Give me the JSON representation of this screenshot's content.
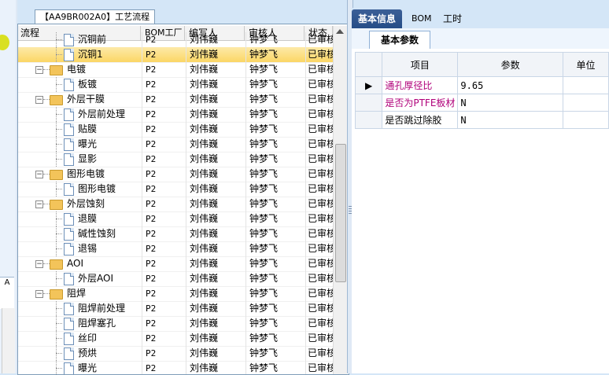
{
  "left_strip": {
    "label_a": "A",
    "label_b": ""
  },
  "process_panel": {
    "tab_label": "【AA9BR002A0】工艺流程",
    "columns": [
      "流程",
      "BOM工厂",
      "编写人",
      "审核人",
      "状态"
    ],
    "rows": [
      {
        "name": "沉铜前",
        "level": 2,
        "type": "doc",
        "bom": "P2",
        "writer": "刘伟巍",
        "reviewer": "钟梦飞",
        "status": "已审核",
        "selected": false
      },
      {
        "name": "沉铜1",
        "level": 2,
        "type": "doc",
        "bom": "P2",
        "writer": "刘伟巍",
        "reviewer": "钟梦飞",
        "status": "已审核",
        "selected": true
      },
      {
        "name": "电镀",
        "level": 1,
        "type": "folder",
        "bom": "P2",
        "writer": "刘伟巍",
        "reviewer": "钟梦飞",
        "status": "已审核",
        "selected": false
      },
      {
        "name": "板镀",
        "level": 2,
        "type": "doc",
        "bom": "P2",
        "writer": "刘伟巍",
        "reviewer": "钟梦飞",
        "status": "已审核",
        "selected": false
      },
      {
        "name": "外层干膜",
        "level": 1,
        "type": "folder",
        "bom": "P2",
        "writer": "刘伟巍",
        "reviewer": "钟梦飞",
        "status": "已审核",
        "selected": false
      },
      {
        "name": "外层前处理",
        "level": 2,
        "type": "doc",
        "bom": "P2",
        "writer": "刘伟巍",
        "reviewer": "钟梦飞",
        "status": "已审核",
        "selected": false
      },
      {
        "name": "贴膜",
        "level": 2,
        "type": "doc",
        "bom": "P2",
        "writer": "刘伟巍",
        "reviewer": "钟梦飞",
        "status": "已审核",
        "selected": false
      },
      {
        "name": "曝光",
        "level": 2,
        "type": "doc",
        "bom": "P2",
        "writer": "刘伟巍",
        "reviewer": "钟梦飞",
        "status": "已审核",
        "selected": false
      },
      {
        "name": "显影",
        "level": 2,
        "type": "doc",
        "bom": "P2",
        "writer": "刘伟巍",
        "reviewer": "钟梦飞",
        "status": "已审核",
        "selected": false
      },
      {
        "name": "图形电镀",
        "level": 1,
        "type": "folder",
        "bom": "P2",
        "writer": "刘伟巍",
        "reviewer": "钟梦飞",
        "status": "已审核",
        "selected": false
      },
      {
        "name": "图形电镀",
        "level": 2,
        "type": "doc",
        "bom": "P2",
        "writer": "刘伟巍",
        "reviewer": "钟梦飞",
        "status": "已审核",
        "selected": false
      },
      {
        "name": "外层蚀刻",
        "level": 1,
        "type": "folder",
        "bom": "P2",
        "writer": "刘伟巍",
        "reviewer": "钟梦飞",
        "status": "已审核",
        "selected": false
      },
      {
        "name": "退膜",
        "level": 2,
        "type": "doc",
        "bom": "P2",
        "writer": "刘伟巍",
        "reviewer": "钟梦飞",
        "status": "已审核",
        "selected": false
      },
      {
        "name": "碱性蚀刻",
        "level": 2,
        "type": "doc",
        "bom": "P2",
        "writer": "刘伟巍",
        "reviewer": "钟梦飞",
        "status": "已审核",
        "selected": false
      },
      {
        "name": "退锡",
        "level": 2,
        "type": "doc",
        "bom": "P2",
        "writer": "刘伟巍",
        "reviewer": "钟梦飞",
        "status": "已审核",
        "selected": false
      },
      {
        "name": "AOI",
        "level": 1,
        "type": "folder",
        "bom": "P2",
        "writer": "刘伟巍",
        "reviewer": "钟梦飞",
        "status": "已审核",
        "selected": false
      },
      {
        "name": "外层AOI",
        "level": 2,
        "type": "doc",
        "bom": "P2",
        "writer": "刘伟巍",
        "reviewer": "钟梦飞",
        "status": "已审核",
        "selected": false
      },
      {
        "name": "阻焊",
        "level": 1,
        "type": "folder",
        "bom": "P2",
        "writer": "刘伟巍",
        "reviewer": "钟梦飞",
        "status": "已审核",
        "selected": false
      },
      {
        "name": "阻焊前处理",
        "level": 2,
        "type": "doc",
        "bom": "P2",
        "writer": "刘伟巍",
        "reviewer": "钟梦飞",
        "status": "已审核",
        "selected": false
      },
      {
        "name": "阻焊塞孔",
        "level": 2,
        "type": "doc",
        "bom": "P2",
        "writer": "刘伟巍",
        "reviewer": "钟梦飞",
        "status": "已审核",
        "selected": false
      },
      {
        "name": "丝印",
        "level": 2,
        "type": "doc",
        "bom": "P2",
        "writer": "刘伟巍",
        "reviewer": "钟梦飞",
        "status": "已审核",
        "selected": false
      },
      {
        "name": "预烘",
        "level": 2,
        "type": "doc",
        "bom": "P2",
        "writer": "刘伟巍",
        "reviewer": "钟梦飞",
        "status": "已审核",
        "selected": false
      },
      {
        "name": "曝光",
        "level": 2,
        "type": "doc",
        "bom": "P2",
        "writer": "刘伟巍",
        "reviewer": "钟梦飞",
        "status": "已审核",
        "selected": false
      }
    ]
  },
  "right_panel": {
    "tabs": [
      "基本信息",
      "BOM",
      "工时"
    ],
    "active_tab": 0,
    "sub_tab": "基本参数",
    "table": {
      "headers": [
        "项目",
        "参数",
        "单位"
      ],
      "rows": [
        {
          "item": "通孔厚径比",
          "value": "9.65",
          "unit": "",
          "current": true,
          "highlight": true
        },
        {
          "item": "是否为PTFE板材",
          "value": "N",
          "unit": "",
          "current": false,
          "highlight": true
        },
        {
          "item": "是否跳过除胶",
          "value": "N",
          "unit": "",
          "current": false,
          "highlight": false
        }
      ]
    }
  },
  "colors": {
    "accent": "#254d87",
    "selected_row": "#fbd665",
    "magenta_text": "#b0007a"
  },
  "icons": [
    "folder-icon",
    "document-icon",
    "expand-toggle-icon",
    "row-pointer-icon",
    "scroll-up-icon"
  ]
}
